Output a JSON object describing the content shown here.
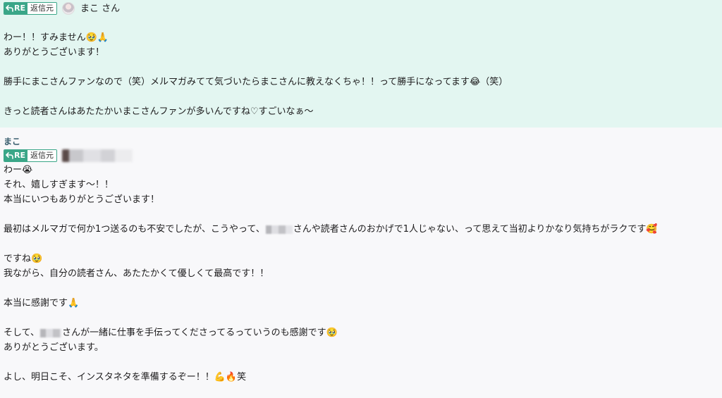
{
  "reply_badge": {
    "re_label": "RE",
    "source_label": "返信元"
  },
  "quoted_message": {
    "author": "まこ さん",
    "lines": [
      "",
      "わー！！すみません🥹🙏",
      "ありがとうございます！",
      "",
      "勝手にまこさんファンなので（笑）メルマガみてて気づいたらまこさんに教えなくちゃ！！って勝手になってます😂（笑）",
      "",
      "きっと読者さんはあたたかいまこさんファンが多いんですね♡すごいなぁ〜"
    ]
  },
  "reply_message": {
    "sender": "まこ",
    "line_1": "わー😭",
    "line_2": "それ、嬉しすぎます〜！！",
    "line_3": "本当にいつもありがとうございます！",
    "line_4a": "最初はメルマガで何か1つ送るのも不安でしたが、こうやって、",
    "line_4b": "さんや読者さんのおかげで1人じゃない、って思えて当初よりかなり気持ちがラクです🥰",
    "line_5": "ですね🥹",
    "line_6": "我ながら、自分の読者さん、あたたかくて優しくて最高です！！",
    "line_7": "本当に感謝です🙏",
    "line_8a": "そして、",
    "line_8b": "さんが一緒に仕事を手伝ってくださってるっていうのも感謝です🥹",
    "line_9": "ありがとうございます。",
    "line_10": "よし、明日こそ、インスタネタを準備するぞー！！💪🔥笑"
  },
  "colors": {
    "highlight_bg": "#e3f6f1",
    "normal_bg": "#f8f8fa",
    "badge_green": "#3aa688",
    "sender_color": "#3a5f6f"
  }
}
